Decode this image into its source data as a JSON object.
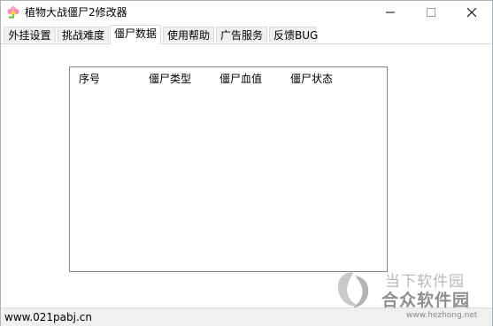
{
  "window": {
    "title": "植物大战僵尸2修改器",
    "controls": {
      "minimize": "minimize",
      "maximize": "maximize",
      "close": "close"
    }
  },
  "tabs": [
    {
      "label": "外挂设置",
      "active": false
    },
    {
      "label": "挑战难度",
      "active": false
    },
    {
      "label": "僵尸数据",
      "active": true
    },
    {
      "label": "使用帮助",
      "active": false
    },
    {
      "label": "广告服务",
      "active": false
    },
    {
      "label": "反馈BUG",
      "active": false
    }
  ],
  "table": {
    "columns": [
      "序号",
      "僵尸类型",
      "僵尸血值",
      "僵尸状态"
    ],
    "rows": []
  },
  "status": {
    "url": "www.021pabj.cn"
  },
  "watermark": {
    "line1": "当下软件园",
    "line2": "合众软件园",
    "line3": "www.hezhong.net"
  },
  "colors": {
    "tab_inactive": "#f0f0f0",
    "tab_active": "#ffffff",
    "border": "#828790",
    "statusbar": "#f0f0f0"
  },
  "icons": {
    "app": "flower-icon",
    "minimize": "minimize-icon",
    "maximize": "maximize-icon",
    "close": "close-icon",
    "watermark_logo": "watermark-logo-icon"
  }
}
